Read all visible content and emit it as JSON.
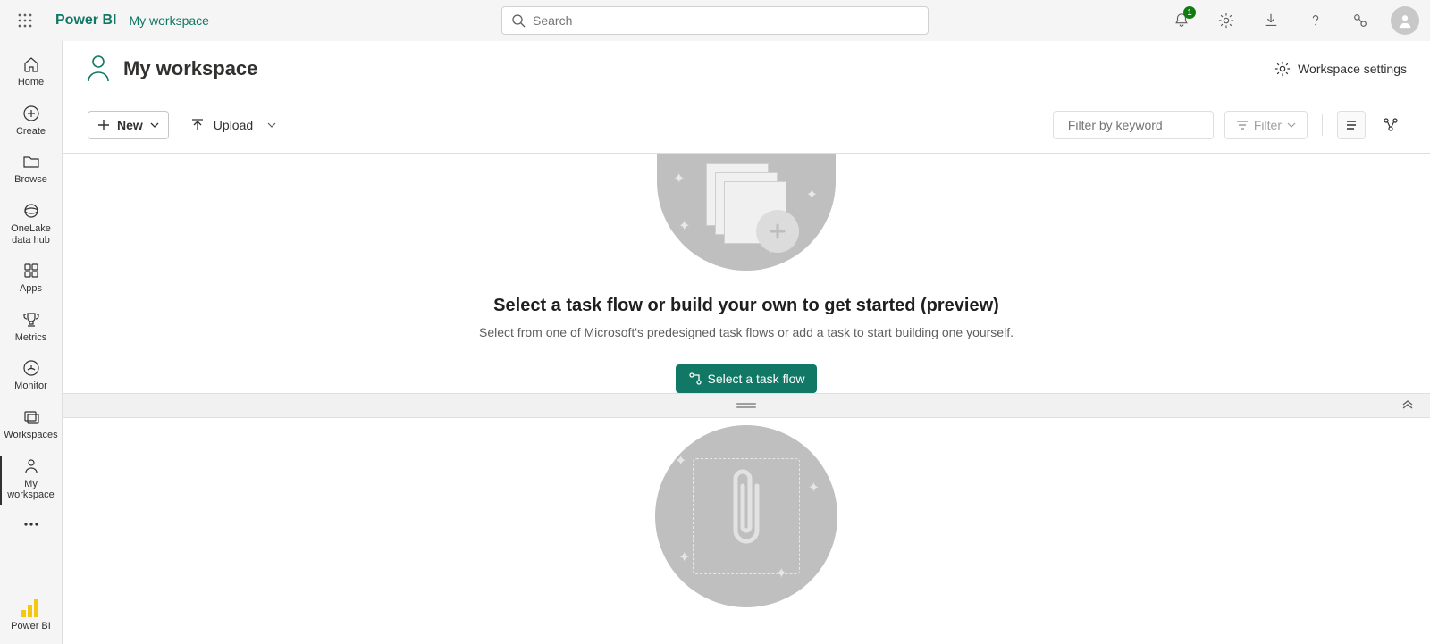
{
  "topbar": {
    "brand": "Power BI",
    "breadcrumb": "My workspace",
    "search_placeholder": "Search",
    "notification_badge": "1"
  },
  "sidebar": {
    "items": [
      {
        "label": "Home"
      },
      {
        "label": "Create"
      },
      {
        "label": "Browse"
      },
      {
        "label": "OneLake data hub"
      },
      {
        "label": "Apps"
      },
      {
        "label": "Metrics"
      },
      {
        "label": "Monitor"
      },
      {
        "label": "Workspaces"
      },
      {
        "label": "My workspace"
      }
    ],
    "footer_label": "Power BI"
  },
  "workspace": {
    "title": "My workspace",
    "settings_label": "Workspace settings"
  },
  "toolbar": {
    "new_label": "New",
    "upload_label": "Upload",
    "filter_keyword_placeholder": "Filter by keyword",
    "filter_label": "Filter"
  },
  "taskflow": {
    "title": "Select a task flow or build your own to get started (preview)",
    "subtitle": "Select from one of Microsoft's predesigned task flows or add a task to start building one yourself.",
    "primary_button": "Select a task flow"
  }
}
